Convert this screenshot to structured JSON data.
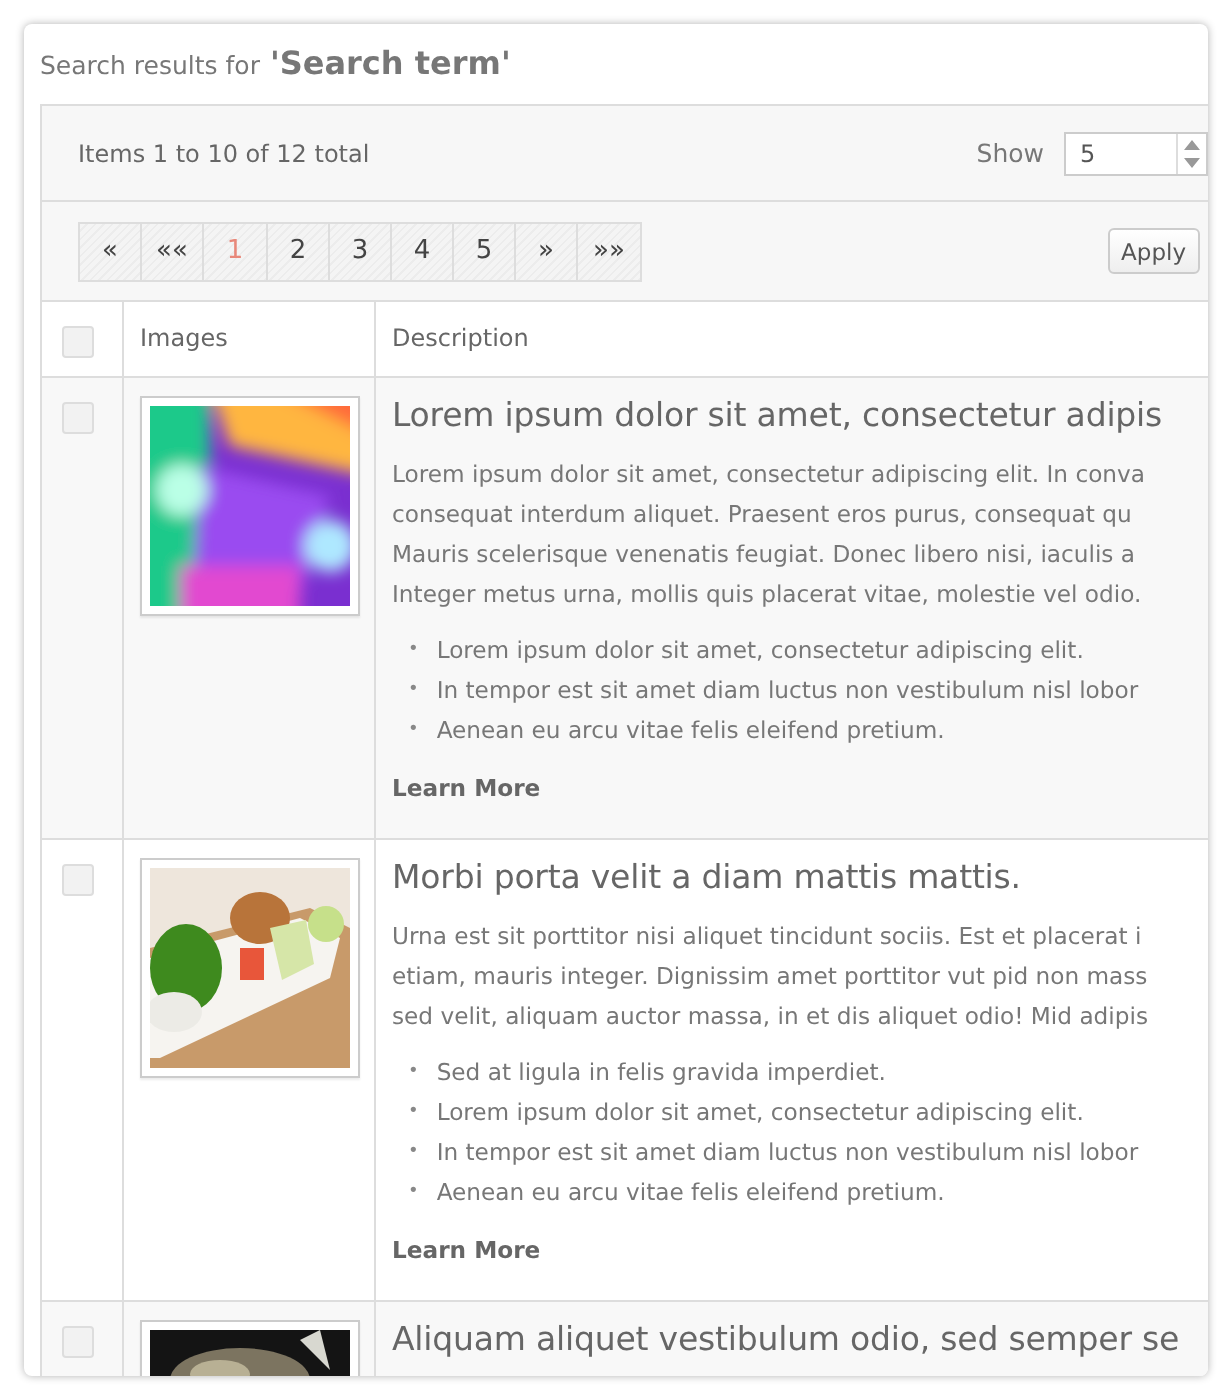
{
  "heading": {
    "prefix": "Search results for",
    "term": "'Search term'"
  },
  "summary": "Items 1 to 10 of 12 total",
  "show": {
    "label": "Show",
    "value": "5"
  },
  "pagination": [
    {
      "label": "«",
      "selected": false
    },
    {
      "label": "««",
      "selected": false
    },
    {
      "label": "1",
      "selected": true
    },
    {
      "label": "2",
      "selected": false
    },
    {
      "label": "3",
      "selected": false
    },
    {
      "label": "4",
      "selected": false
    },
    {
      "label": "5",
      "selected": false
    },
    {
      "label": "»",
      "selected": false
    },
    {
      "label": "»»",
      "selected": false
    }
  ],
  "apply_button": "Apply",
  "table": {
    "select_all": {
      "checked": false
    },
    "columns": [
      "Images",
      "Description"
    ],
    "rows": [
      {
        "checked": false,
        "title": "Lorem ipsum dolor sit amet, consectetur adipis",
        "paragraph": [
          "Lorem ipsum dolor sit amet, consectetur adipiscing elit. In conva",
          "consequat interdum aliquet. Praesent eros purus, consequat qu",
          "Mauris scelerisque venenatis feugiat. Donec libero nisi, iaculis a",
          "Integer metus urna, mollis quis placerat vitae, molestie vel odio."
        ],
        "bullets": [
          {
            "marker": "•",
            "text": "Lorem ipsum dolor sit amet, consectetur adipiscing elit."
          },
          {
            "marker": "•",
            "text": "In tempor est sit amet diam luctus non vestibulum nisl lobor"
          },
          {
            "marker": "•",
            "text": "Aenean eu arcu vitae felis eleifend pretium."
          }
        ],
        "link": "Learn More"
      },
      {
        "checked": false,
        "title": "Morbi porta velit a diam mattis mattis.",
        "paragraph": [
          "Urna est sit porttitor nisi aliquet tincidunt sociis. Est et placerat i",
          "etiam, mauris integer. Dignissim amet porttitor vut pid non mass",
          "sed velit, aliquam auctor massa, in et dis aliquet odio! Mid adipis"
        ],
        "bullets": [
          {
            "marker": "•",
            "text": "Sed at ligula in felis gravida imperdiet."
          },
          {
            "marker": "•",
            "text": "Lorem ipsum dolor sit amet, consectetur adipiscing elit."
          },
          {
            "marker": "•",
            "text": "In tempor est sit amet diam luctus non vestibulum nisl lobor"
          },
          {
            "marker": "•",
            "text": "Aenean eu arcu vitae felis eleifend pretium."
          }
        ],
        "link": "Learn More"
      },
      {
        "checked": false,
        "title": "Aliquam aliquet vestibulum odio, sed semper se"
      }
    ]
  }
}
